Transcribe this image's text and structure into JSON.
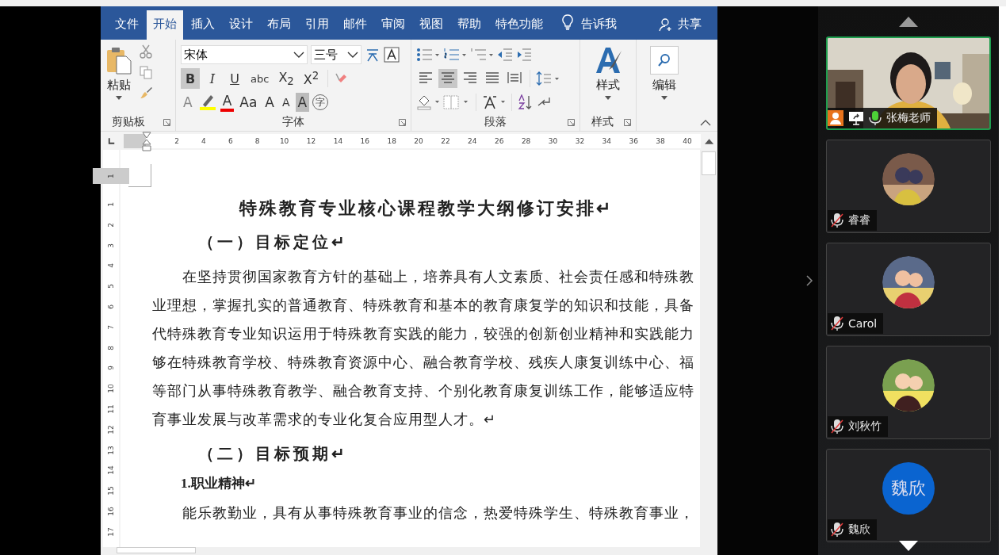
{
  "tabs": [
    {
      "label": "文件",
      "selected": false
    },
    {
      "label": "开始",
      "selected": true
    },
    {
      "label": "插入",
      "selected": false
    },
    {
      "label": "设计",
      "selected": false
    },
    {
      "label": "布局",
      "selected": false
    },
    {
      "label": "引用",
      "selected": false
    },
    {
      "label": "邮件",
      "selected": false
    },
    {
      "label": "审阅",
      "selected": false
    },
    {
      "label": "视图",
      "selected": false
    },
    {
      "label": "帮助",
      "selected": false
    },
    {
      "label": "特色功能",
      "selected": false
    }
  ],
  "tell_me": "告诉我",
  "share": "共享",
  "clipboard": {
    "paste": "粘贴",
    "label": "剪贴板"
  },
  "font": {
    "name": "宋体",
    "size": "三号",
    "label": "字体",
    "row1": [
      {
        "kind": "bold",
        "label": "B",
        "on": true
      },
      {
        "kind": "italic",
        "label": "I",
        "on": false
      },
      {
        "kind": "underline",
        "label": "U",
        "on": false
      },
      {
        "kind": "strike",
        "label": "abc",
        "on": false
      },
      {
        "kind": "sub",
        "label": "X$_{2}$",
        "on": false
      },
      {
        "kind": "sup",
        "label": "X$^{2}$",
        "on": false
      }
    ],
    "row2": [
      {
        "kind": "effects",
        "label": "A"
      },
      {
        "kind": "highlight"
      },
      {
        "kind": "color",
        "label": "A"
      },
      {
        "kind": "case",
        "label": "Aa"
      },
      {
        "kind": "grow",
        "label": "A"
      },
      {
        "kind": "shrink",
        "label": "A"
      },
      {
        "kind": "shade",
        "label": "A"
      },
      {
        "kind": "enclose",
        "label": "字"
      }
    ]
  },
  "paragraph": {
    "label": "段落",
    "align": [
      {
        "on": false
      },
      {
        "on": true
      },
      {
        "on": false
      },
      {
        "on": false
      },
      {
        "on": false
      }
    ]
  },
  "styles": {
    "button": "样式",
    "label": "样式"
  },
  "editing": {
    "button": "编辑"
  },
  "ruler": [
    "2",
    "4",
    "6",
    "8",
    "10",
    "12",
    "14",
    "16",
    "18",
    "20",
    "22",
    "24",
    "26",
    "28",
    "30",
    "32",
    "34",
    "36",
    "38",
    "40"
  ],
  "vertical_ruler": [
    "1",
    "1",
    "2",
    "3",
    "4",
    "5",
    "6",
    "7",
    "8",
    "9",
    "10",
    "11",
    "12",
    "13",
    "14",
    "15",
    "16",
    "17"
  ],
  "document": {
    "title": "特殊教育专业核心课程教学大纲修订安排↵",
    "heading1": "（一）目标定位↵",
    "para1": [
      "在坚持贯彻国家教育方针的基础上，培养具有人文素质、社会责任感和特殊教",
      "业理想，掌握扎实的普通教育、特殊教育和基本的教育康复学的知识和技能，具备",
      "代特殊教育专业知识运用于特殊教育实践的能力，较强的创新创业精神和实践能力",
      "够在特殊教育学校、特殊教育资源中心、融合教育学校、残疾人康复训练中心、福",
      "等部门从事特殊教育教学、融合教育支持、个别化教育康复训练工作，能够适应特",
      "育事业发展与改革需求的专业化复合应用型人才。↵"
    ],
    "heading2": "（二）目标预期↵",
    "heading3": "1.职业精神↵",
    "para2": [
      "能乐教勤业，具有从事特殊教育事业的信念，热爱特殊学生、特殊教育事业，"
    ]
  },
  "participants": [
    {
      "name": "张梅老师",
      "kind": "video",
      "host": true,
      "mic_muted": false,
      "selected": true
    },
    {
      "name": "睿睿",
      "host": false,
      "mic_muted": true,
      "selected": false
    },
    {
      "name": "Carol",
      "host": false,
      "mic_muted": true,
      "selected": false
    },
    {
      "name": "刘秋竹",
      "host": false,
      "mic_muted": true,
      "selected": false
    },
    {
      "name": "魏欣",
      "kind": "initials",
      "initials": "魏欣",
      "host": false,
      "mic_muted": true,
      "selected": false
    }
  ]
}
